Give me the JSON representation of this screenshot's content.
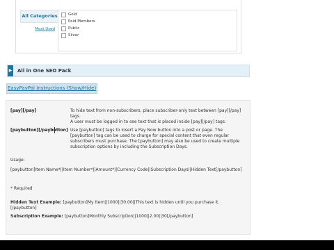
{
  "categories": {
    "tabs": [
      {
        "label": "All Categories",
        "active": true
      },
      {
        "label": "Most Used",
        "active": false
      }
    ],
    "items": [
      "Gold",
      "Paid Members",
      "Public",
      "Silver"
    ]
  },
  "seo_box": {
    "title": "All in One SEO Pack"
  },
  "easypaypal": {
    "toggle_link": "EasyPayPal Instructions (Show/Hide)",
    "pay": {
      "term": "[pay][/pay]",
      "desc_1": "To hide text from non-subscribers, place subscriber-only text between [pay][/pay] tags.",
      "desc_2": "A user must be logged in to see text that is placed inside [pay][/pay] tags."
    },
    "paybutton": {
      "term": "[paybutton][/paybutton]",
      "desc": "Use [paybutton] tags to insert a Pay Now button into a post or page. The [paybutton] tag can be used to charge for special content that even regular subscribers must purchase. The [paybutton] may also be used to create multiple subscription options by including the Subscription Days."
    },
    "usage_label": "Usage:",
    "usage_syntax": "[paybutton]Item Name*||Item Number*||Amount*||Currency Code||Subscription Days||Hidden Text[/paybutton]",
    "required_note": "* Required",
    "hidden_example_label": "Hidden Text Example:",
    "hidden_example_value": "[paybutton]My Item||1000||30.00||This text is hidden until you purchase it.[/paybutton]",
    "subscription_example_label": "Subscription Example:",
    "subscription_example_value": "[paybutton]Monthly Subscription||1000||2.00||30[/paybutton]"
  },
  "colors": {
    "link": "#21759b",
    "bar_bg": "#e4f0f8",
    "panel_bg": "#f5f5f5"
  }
}
